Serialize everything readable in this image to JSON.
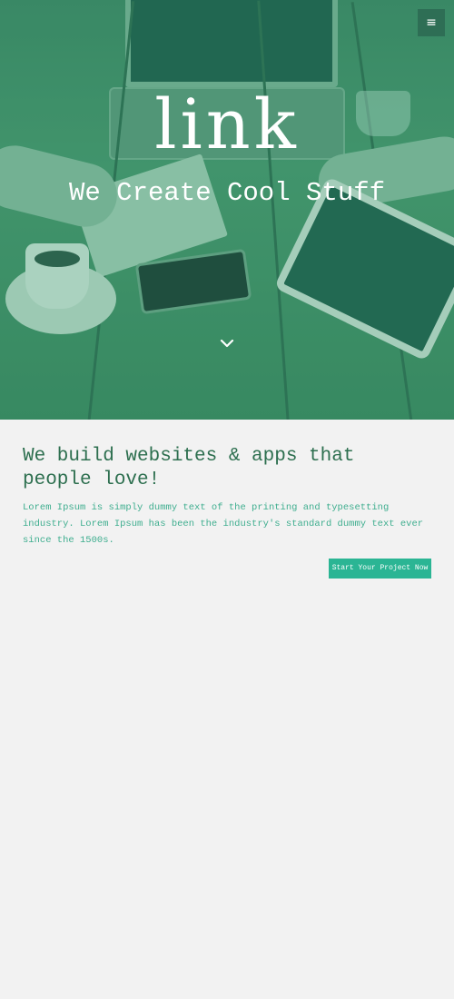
{
  "header": {
    "menu_icon": "hamburger-menu-icon",
    "menu_glyph": "≡"
  },
  "hero": {
    "title": "link",
    "subtitle": "We Create Cool Stuff",
    "scroll_icon": "chevron-down-icon"
  },
  "intro": {
    "headline": "We build websites & apps that people love!",
    "lead": "Lorem Ipsum is simply dummy text of the printing and typesetting industry. Lorem Ipsum has been the industry's standard dummy text ever since the 1500s.",
    "cta_label": "Start Your Project Now"
  },
  "colors": {
    "accent": "#2bb594",
    "headline": "#2d6f4f",
    "hero_tint": "#3f8a67"
  }
}
